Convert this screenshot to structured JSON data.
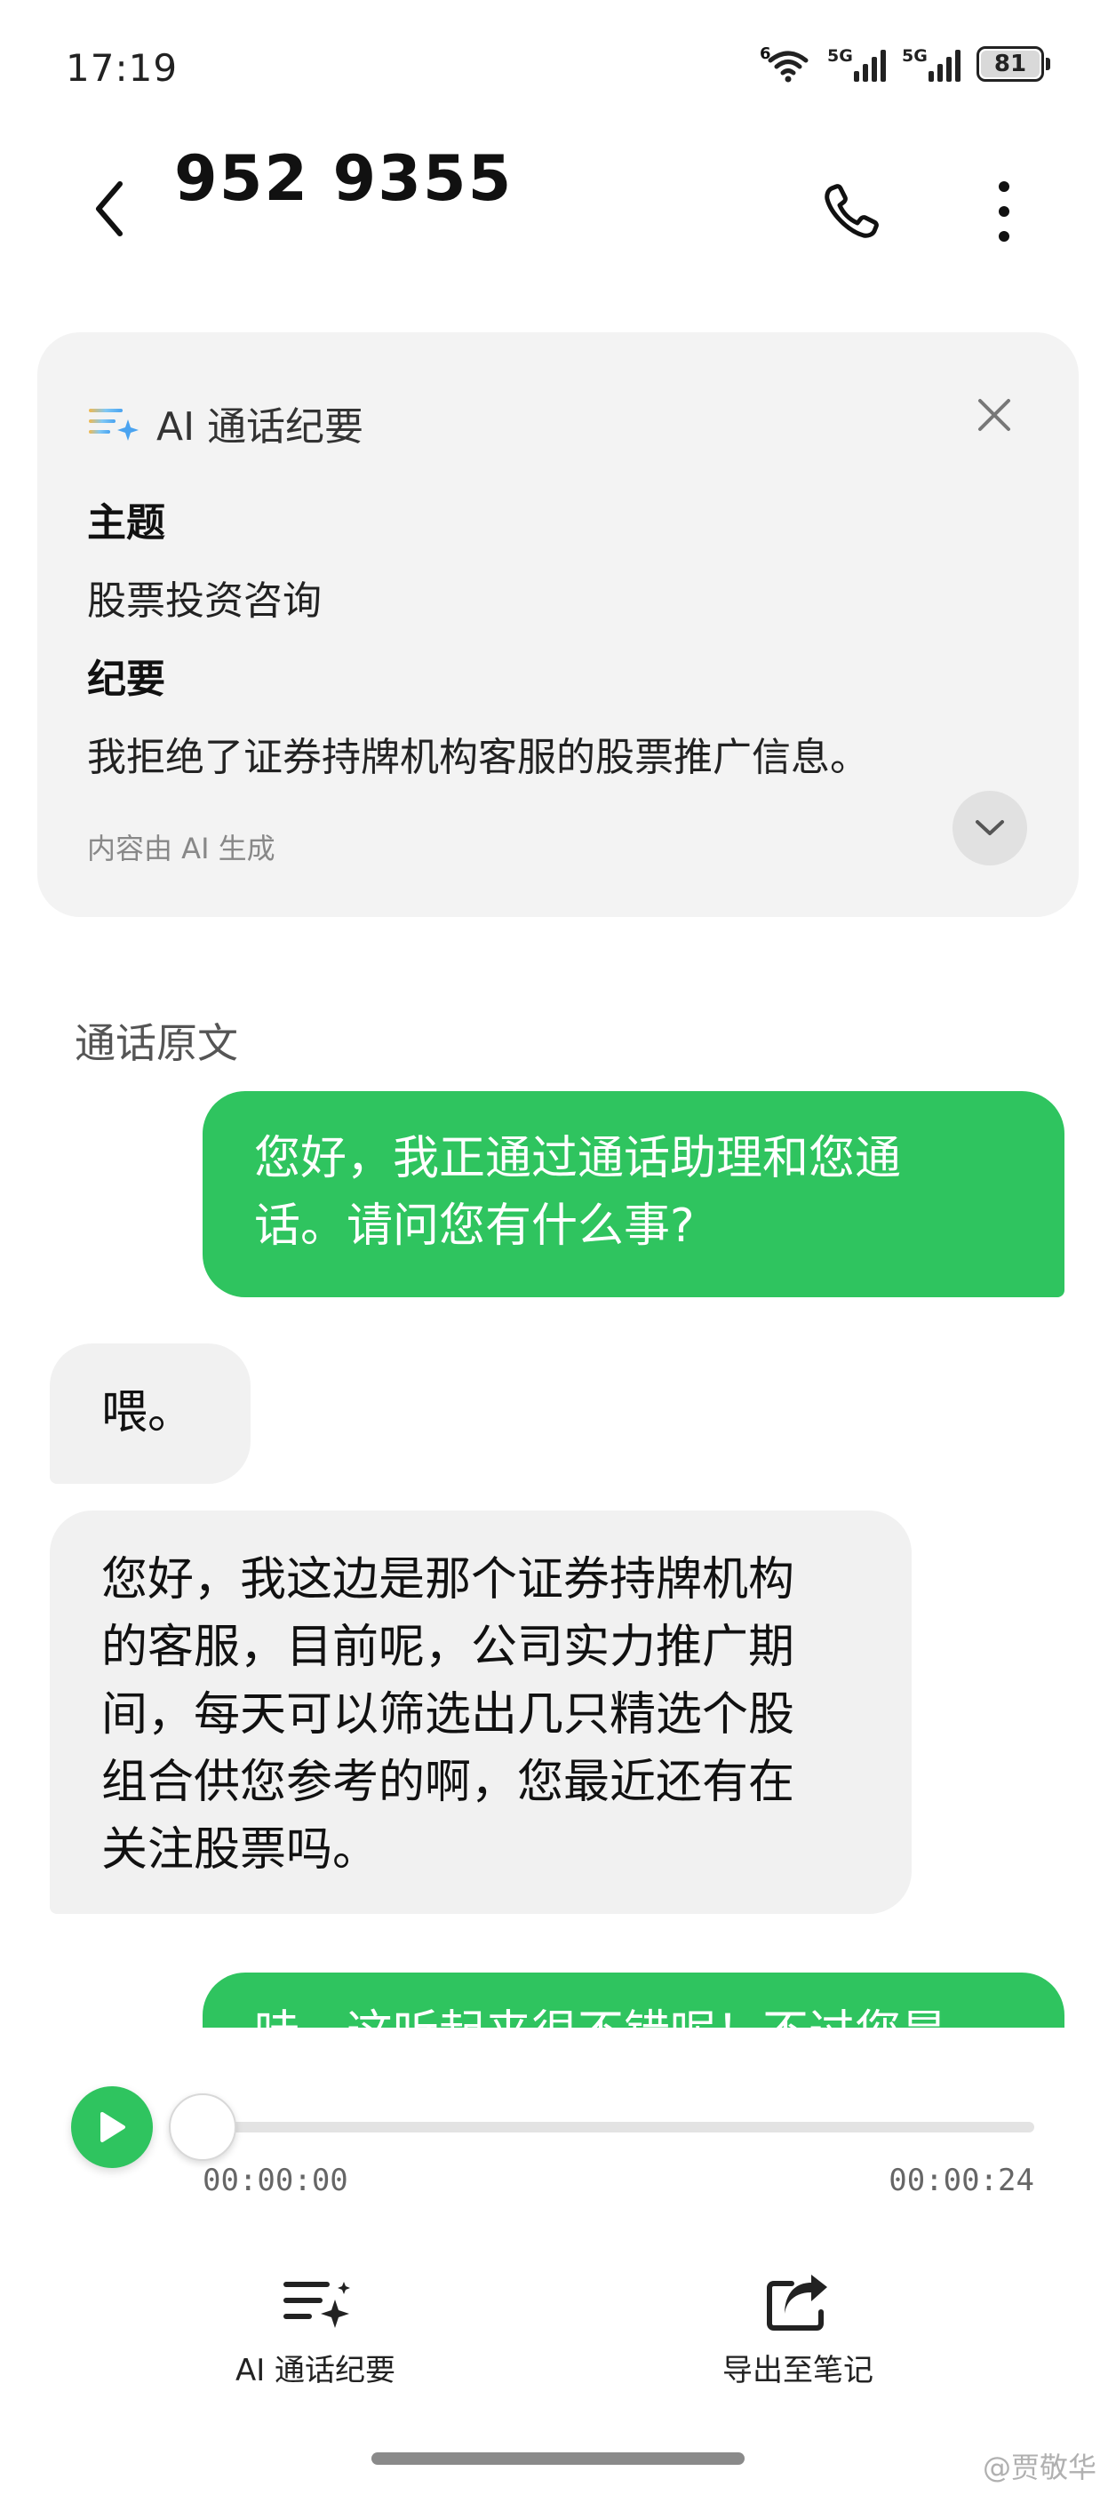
{
  "status_bar": {
    "time": "17:19",
    "wifi_tag": "6",
    "signal1_tag": "5G",
    "signal2_tag": "5G",
    "battery": "81",
    "icons": [
      "wifi-icon",
      "signal-icon",
      "signal-icon",
      "battery-icon"
    ]
  },
  "header": {
    "title": "952 9355",
    "icons": [
      "back-arrow-icon",
      "phone-icon",
      "more-vertical-icon"
    ]
  },
  "summary": {
    "title": "AI 通话纪要",
    "topic_label": "主题",
    "topic": "股票投资咨询",
    "summary_label": "纪要",
    "summary": "我拒绝了证券持牌机构客服的股票推广信息。",
    "footnote": "内容由 AI 生成",
    "icons": [
      "ai-sparkle-icon",
      "close-icon",
      "chevron-down-icon"
    ]
  },
  "transcript": {
    "heading": "通话原文",
    "messages": [
      {
        "side": "out",
        "lines": [
          "您好，我正通过通话助理和您通",
          "话。请问您有什么事?"
        ]
      },
      {
        "side": "in",
        "lines": [
          "喂。"
        ]
      },
      {
        "side": "in",
        "lines": [
          "您好，我这边是那个证券持牌机构",
          "的客服，目前呢，公司实力推广期",
          "间，每天可以筛选出几只精选个股",
          "组合供您参考的啊，您最近还有在",
          "关注股票吗。"
        ]
      },
      {
        "side": "out",
        "lines": [
          "哇，这听起来很不错呢！不过您是"
        ]
      }
    ]
  },
  "player": {
    "current": "00:00:00",
    "total": "00:00:24",
    "progress": 0,
    "icons": [
      "play-icon"
    ]
  },
  "actions": {
    "summary_label": "AI 通话纪要",
    "export_label": "导出至笔记",
    "icons": [
      "summary-list-icon",
      "export-share-icon"
    ]
  },
  "watermark": "@贾敬华",
  "colors": {
    "accent_green": "#2fc45f",
    "card_bg": "#f3f3f3",
    "incoming_bubble": "#f1f1f1"
  }
}
